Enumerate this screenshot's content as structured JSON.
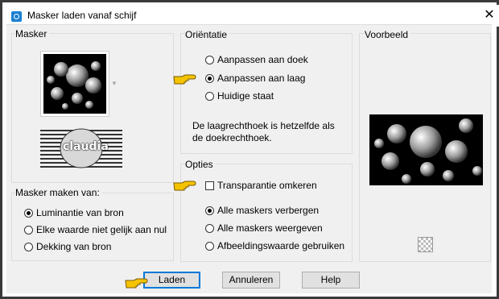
{
  "window": {
    "title": "Masker laden vanaf schijf",
    "close_glyph": "✕"
  },
  "mask_group": {
    "label": "Masker",
    "thumbnail_text": "claudia"
  },
  "source_group": {
    "label": "Masker maken van:",
    "options": [
      "Luminantie van bron",
      "Elke waarde niet gelijk aan nul",
      "Dekking van bron"
    ],
    "selected": 0
  },
  "orientation_group": {
    "label": "Oriëntatie",
    "options": [
      "Aanpassen aan doek",
      "Aanpassen aan laag",
      "Huidige staat"
    ],
    "selected": 1,
    "note_line1": "De laagrechthoek is hetzelfde als",
    "note_line2": "de doekrechthoek."
  },
  "options_group": {
    "label": "Opties",
    "invert_label": "Transparantie omkeren",
    "invert_checked": false,
    "mask_options": [
      "Alle maskers verbergen",
      "Alle maskers weergeven",
      "Afbeeldingswaarde gebruiken"
    ],
    "selected": 0
  },
  "preview_group": {
    "label": "Voorbeeld"
  },
  "buttons": {
    "load": "Laden",
    "cancel": "Annuleren",
    "help": "Help"
  },
  "colors": {
    "accent": "#0078d7",
    "hand": "#f5c400"
  }
}
